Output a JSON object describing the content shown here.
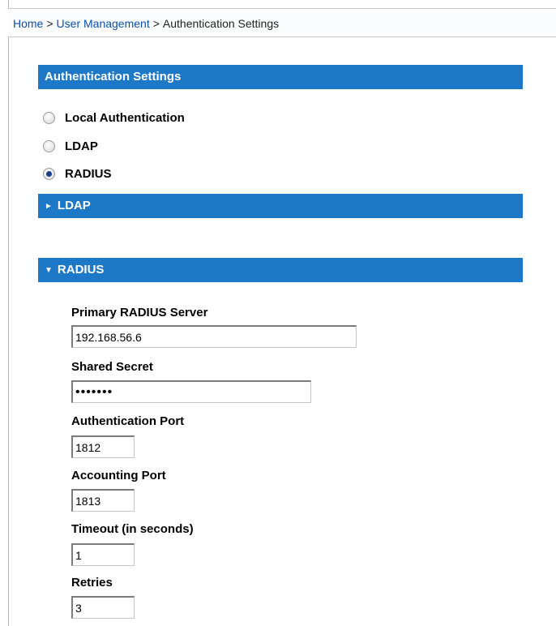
{
  "breadcrumb": {
    "home": "Home",
    "sep1": ">",
    "user_management": "User Management",
    "sep2": ">",
    "current": "Authentication Settings"
  },
  "auth_settings": {
    "title": "Authentication Settings",
    "options": [
      {
        "label": "Local Authentication",
        "checked": false
      },
      {
        "label": "LDAP",
        "checked": false
      },
      {
        "label": "RADIUS",
        "checked": true
      }
    ]
  },
  "ldap_section": {
    "arrow": "►",
    "title": "LDAP",
    "expanded": false
  },
  "radius_section": {
    "arrow": "▼",
    "title": "RADIUS",
    "expanded": true,
    "primary_server_label": "Primary RADIUS Server",
    "primary_server_value": "192.168.56.6",
    "shared_secret_label": "Shared Secret",
    "shared_secret_value": "•••••••",
    "auth_port_label": "Authentication Port",
    "auth_port_value": "1812",
    "acct_port_label": "Accounting Port",
    "acct_port_value": "1813",
    "timeout_label": "Timeout (in seconds)",
    "timeout_value": "1",
    "retries_label": "Retries",
    "retries_value": "3"
  },
  "colors": {
    "section_bar": "#1e78c8",
    "link": "#0b4fae"
  }
}
